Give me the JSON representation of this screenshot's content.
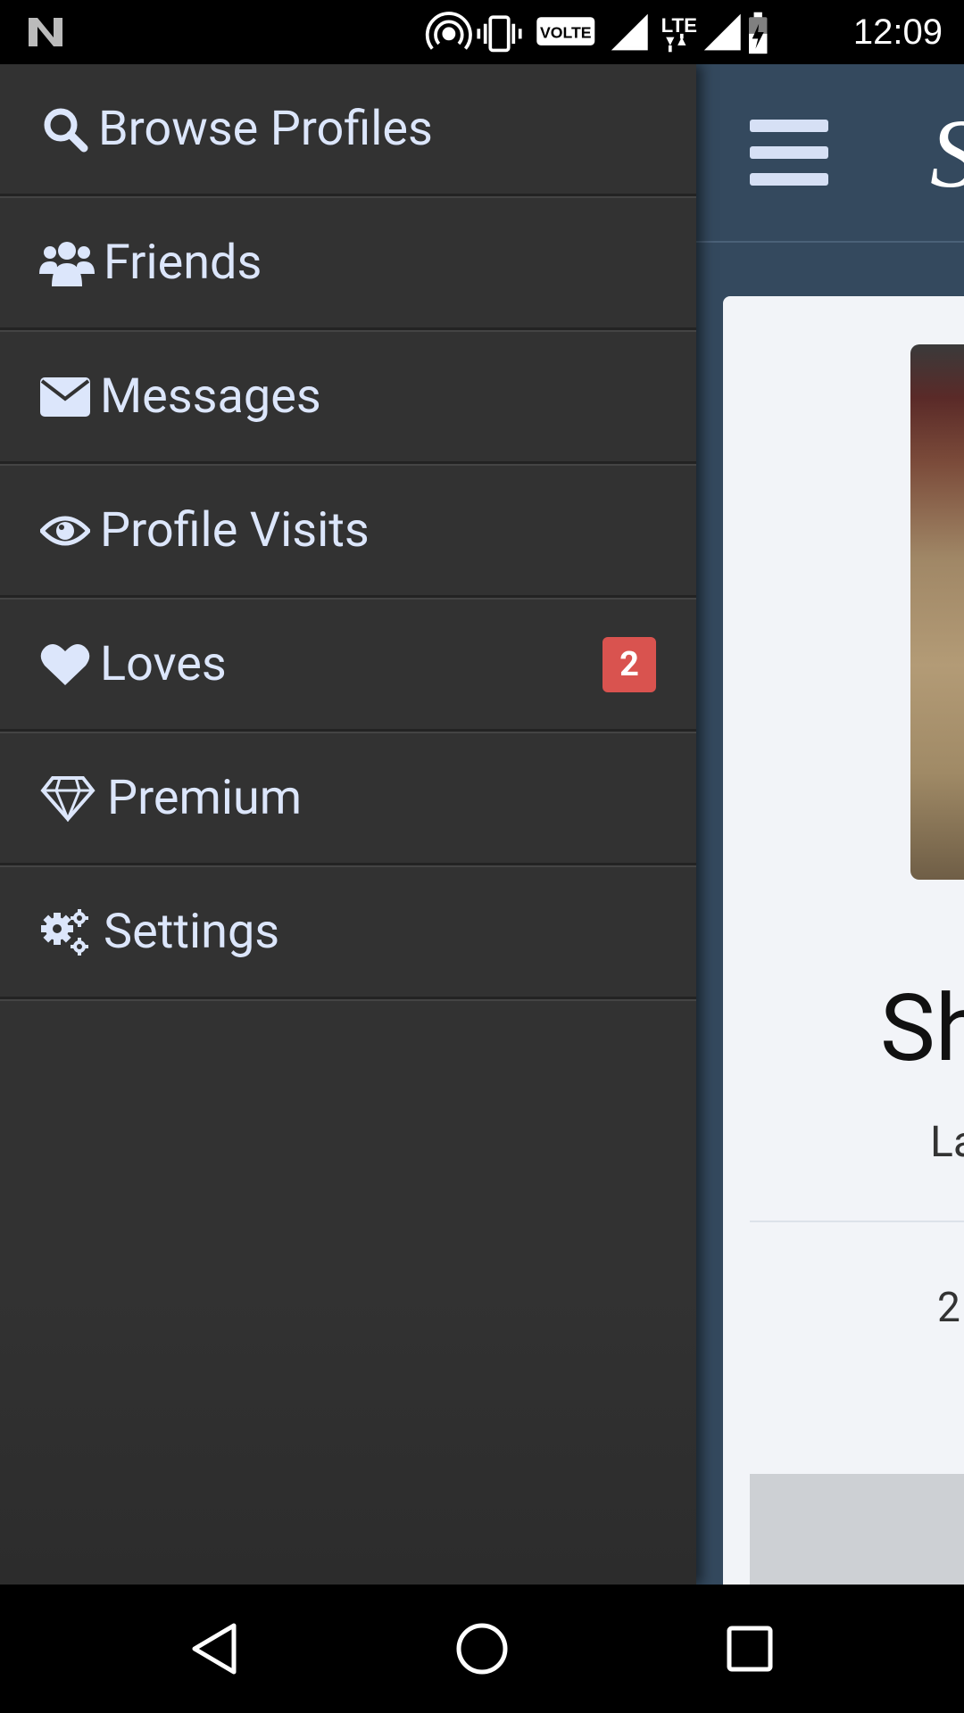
{
  "status_bar": {
    "time": "12:09",
    "icons": [
      "n-logo-icon",
      "hotspot-icon",
      "vibrate-icon",
      "volte-icon",
      "signal-icon",
      "lte-icon",
      "signal-icon",
      "battery-charging-icon"
    ],
    "volte_label": "VOLTE",
    "lte_label": "LTE"
  },
  "drawer": {
    "items": [
      {
        "label": "Browse Profiles",
        "icon": "search-icon"
      },
      {
        "label": "Friends",
        "icon": "users-icon"
      },
      {
        "label": "Messages",
        "icon": "envelope-icon"
      },
      {
        "label": "Profile Visits",
        "icon": "eye-icon"
      },
      {
        "label": "Loves",
        "icon": "heart-icon",
        "badge": "2"
      },
      {
        "label": "Premium",
        "icon": "diamond-icon"
      },
      {
        "label": "Settings",
        "icon": "gears-icon"
      }
    ]
  },
  "app": {
    "logo_glyph": "S",
    "profile_name": "Sh",
    "profile_sub": "La",
    "profile_stat": "2"
  },
  "colors": {
    "drawer_bg": "#323232",
    "drawer_text": "#dce6fb",
    "badge_bg": "#d9534f",
    "app_header_bg": "#34495e"
  }
}
